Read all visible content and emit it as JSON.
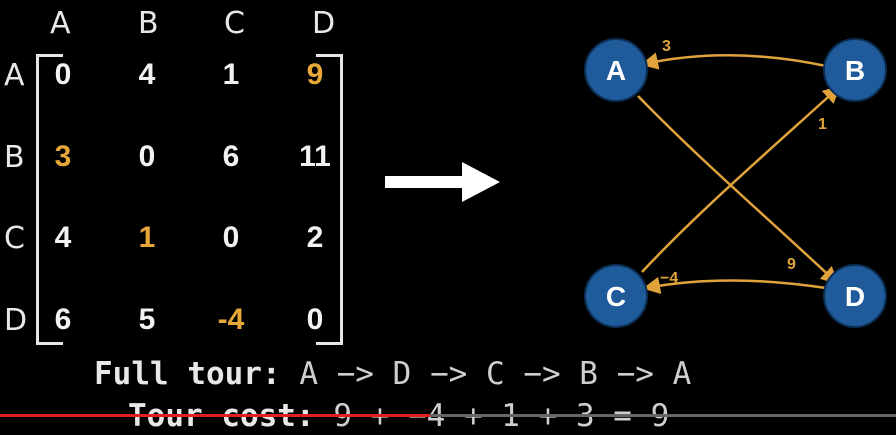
{
  "matrix": {
    "col_headers": [
      "A",
      "B",
      "C",
      "D"
    ],
    "row_headers": [
      "A",
      "B",
      "C",
      "D"
    ],
    "rows": [
      [
        "0",
        "4",
        "1",
        "9"
      ],
      [
        "3",
        "0",
        "6",
        "11"
      ],
      [
        "4",
        "1",
        "0",
        "2"
      ],
      [
        "6",
        "5",
        "-4",
        "0"
      ]
    ],
    "highlighted_cells": [
      [
        0,
        3
      ],
      [
        1,
        0
      ],
      [
        2,
        1
      ],
      [
        3,
        2
      ]
    ],
    "highlight_color": "#e8a838"
  },
  "arrow": {
    "icon": "right-arrow-icon",
    "color": "#ffffff"
  },
  "graph": {
    "node_color": "#1f5a9b",
    "edge_color": "#e0a33c",
    "nodes": [
      "A",
      "B",
      "C",
      "D"
    ],
    "edges": [
      {
        "from": "B",
        "to": "A",
        "weight": "3"
      },
      {
        "from": "C",
        "to": "B",
        "weight": "1"
      },
      {
        "from": "A",
        "to": "D",
        "weight": "9"
      },
      {
        "from": "D",
        "to": "C",
        "weight": "−4"
      }
    ]
  },
  "tour": {
    "full_label": "Full tour:",
    "full_value": "A −> D −> C −> B −> A",
    "cost_label": "Tour cost:",
    "cost_value": "9 + −4 + 1 + 3 = 9"
  },
  "video": {
    "progress_percent": 48
  }
}
